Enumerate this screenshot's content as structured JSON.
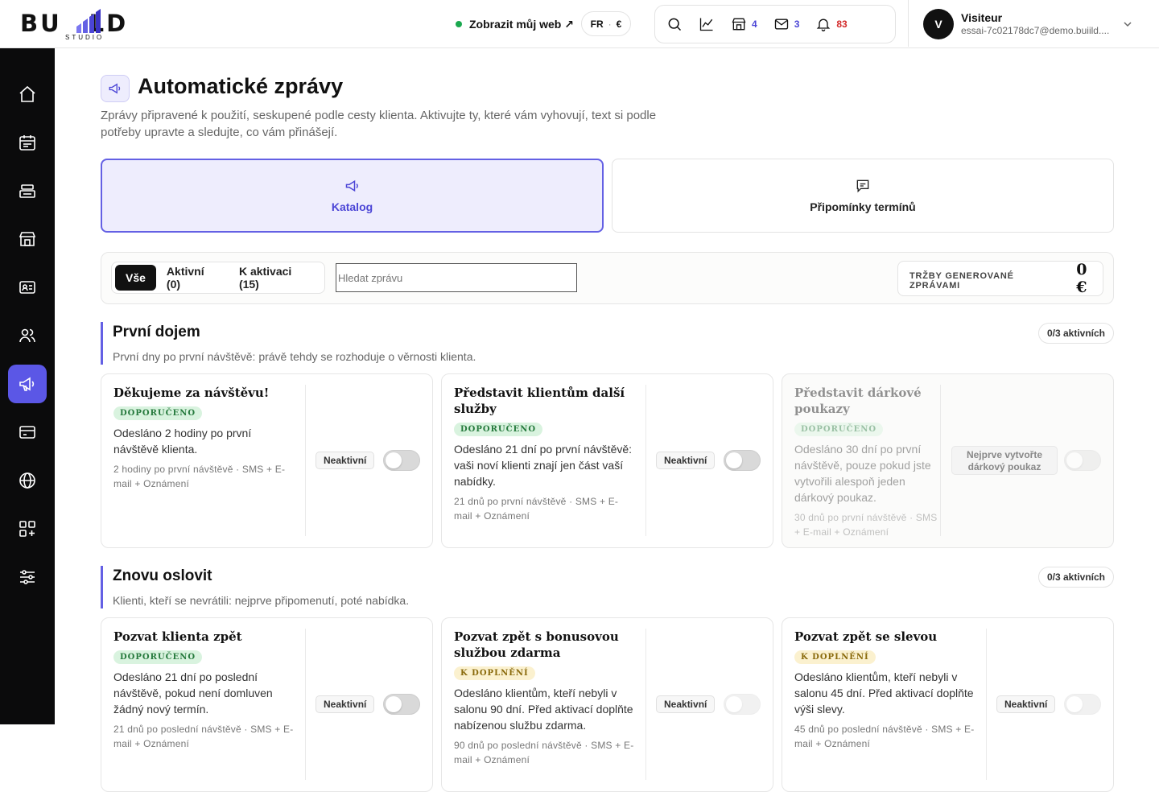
{
  "header": {
    "logo_text": "BUILD",
    "logo_sub": "STUDIO",
    "view_web": "Zobrazit můj web ↗",
    "lang": "FR",
    "currency": "€",
    "counts": {
      "shop": "4",
      "mail": "3",
      "bell": "83"
    },
    "user": {
      "initial": "V",
      "name": "Visiteur",
      "email": "essai-7c02178dc7@demo.buiild...."
    }
  },
  "colors": {
    "accent": "#5b57e6",
    "online": "#1aa84f",
    "alert": "#d32a2a"
  },
  "sidebar": {
    "items": [
      {
        "icon": "home-icon"
      },
      {
        "icon": "calendar-icon"
      },
      {
        "icon": "register-icon"
      },
      {
        "icon": "store-icon"
      },
      {
        "icon": "contact-card-icon"
      },
      {
        "icon": "users-icon"
      },
      {
        "icon": "megaphone-icon",
        "active": true
      },
      {
        "icon": "payment-card-icon"
      },
      {
        "icon": "globe-icon"
      },
      {
        "icon": "apps-add-icon"
      },
      {
        "icon": "settings-sliders-icon"
      }
    ]
  },
  "page": {
    "title": "Automatické zprávy",
    "subtitle": "Zprávy připravené k použití, seskupené podle cesty klienta. Aktivujte ty, které vám vyhovují, text si podle potřeby upravte a sledujte, co vám přinášejí."
  },
  "tabs": [
    {
      "label": "Katalog",
      "active": true
    },
    {
      "label": "Připomínky termínů",
      "active": false
    }
  ],
  "filters": {
    "segments": [
      "Vše",
      "Aktivní (0)",
      "K aktivaci (15)"
    ],
    "search_placeholder": "Hledat zprávu",
    "revenue_label": "TRŽBY GENEROVANÉ ZPRÁVAMI",
    "revenue_value": "0 €"
  },
  "sections": [
    {
      "title": "První dojem",
      "desc": "První dny po první návštěvě: právě tehdy se rozhoduje o věrnosti klienta.",
      "count": "0/3 aktivních",
      "cards": [
        {
          "title": "Děkujeme za návštěvu!",
          "badge": "DOPORUČENO",
          "desc": "Odesláno 2 hodiny po první návštěvě klienta.",
          "meta": "2 hodiny po první návštěvě · SMS + E-mail + Oznámení",
          "status": "Neaktivní"
        },
        {
          "title": "Představit klientům další služby",
          "badge": "DOPORUČENO",
          "desc": "Odesláno 21 dní po první návštěvě: vaši noví klienti znají jen část vaší nabídky.",
          "meta": "21 dnů po první návštěvě · SMS + E-mail + Oznámení",
          "status": "Neaktivní"
        },
        {
          "title": "Představit dárkové poukazy",
          "badge": "DOPORUČENO",
          "desc": "Odesláno 30 dní po první návštěvě, pouze pokud jste vytvořili alespoň jeden dárkový poukaz.",
          "meta": "30 dnů po první návštěvě · SMS + E-mail + Oznámení",
          "note": "Nejprve vytvořte dárkový poukaz"
        }
      ]
    },
    {
      "title": "Znovu oslovit",
      "desc": "Klienti, kteří se nevrátili: nejprve připomenutí, poté nabídka.",
      "count": "0/3 aktivních",
      "cards": [
        {
          "title": "Pozvat klienta zpět",
          "badge": "DOPORUČENO",
          "desc": "Odesláno 21 dní po poslední návštěvě, pokud není domluven žádný nový termín.",
          "meta": "21 dnů po poslední návštěvě · SMS + E-mail + Oznámení",
          "status": "Neaktivní"
        },
        {
          "title": "Pozvat zpět s bonusovou službou zdarma",
          "badge": "K DOPLNĚNÍ",
          "desc": "Odesláno klientům, kteří nebyli v salonu 90 dní. Před aktivací doplňte nabízenou službu zdarma.",
          "meta": "90 dnů po poslední návštěvě · SMS + E-mail + Oznámení",
          "status": "Neaktivní"
        },
        {
          "title": "Pozvat zpět se slevou",
          "badge": "K DOPLNĚNÍ",
          "desc": "Odesláno klientům, kteří nebyli v salonu 45 dní. Před aktivací doplňte výši slevy.",
          "meta": "45 dnů po poslední návštěvě · SMS + E-mail + Oznámení",
          "status": "Neaktivní"
        }
      ]
    }
  ]
}
